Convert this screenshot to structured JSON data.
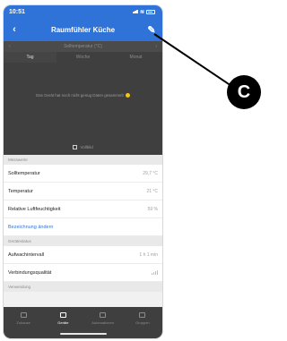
{
  "status_bar": {
    "time": "10:51"
  },
  "nav": {
    "back": "‹",
    "title": "Raumfühler Küche",
    "edit": "✎"
  },
  "chart": {
    "selector": "Solltemperatur (°C)",
    "prev": "‹",
    "next": "›",
    "tabs": [
      "Tag",
      "Woche",
      "Monat"
    ],
    "empty_message": "Das Gerät hat noch nicht genug Daten gesammelt",
    "fullscreen": "Vollbild"
  },
  "sections": {
    "measurements": "Messwerte",
    "device_status": "Gerätestatus",
    "usage": "Verwendung"
  },
  "measurements": [
    {
      "label": "Solltemperatur",
      "value": "29,7 °C"
    },
    {
      "label": "Temperatur",
      "value": "21 °C"
    },
    {
      "label": "Relative Luftfeuchtigkeit",
      "value": "59 %"
    }
  ],
  "rename_link": "Bezeichnung ändern",
  "device_status": [
    {
      "label": "Aufwachintervall",
      "value": "1 h 1 min"
    },
    {
      "label": "Verbindungsqualität",
      "value": ""
    }
  ],
  "tabbar": [
    "Zuhause",
    "Geräte",
    "Automationen",
    "Gruppen"
  ],
  "callout": {
    "label": "C"
  },
  "colors": {
    "accent": "#2f73d9",
    "dark_panel": "#3f3f3f",
    "callout": "#000000"
  }
}
